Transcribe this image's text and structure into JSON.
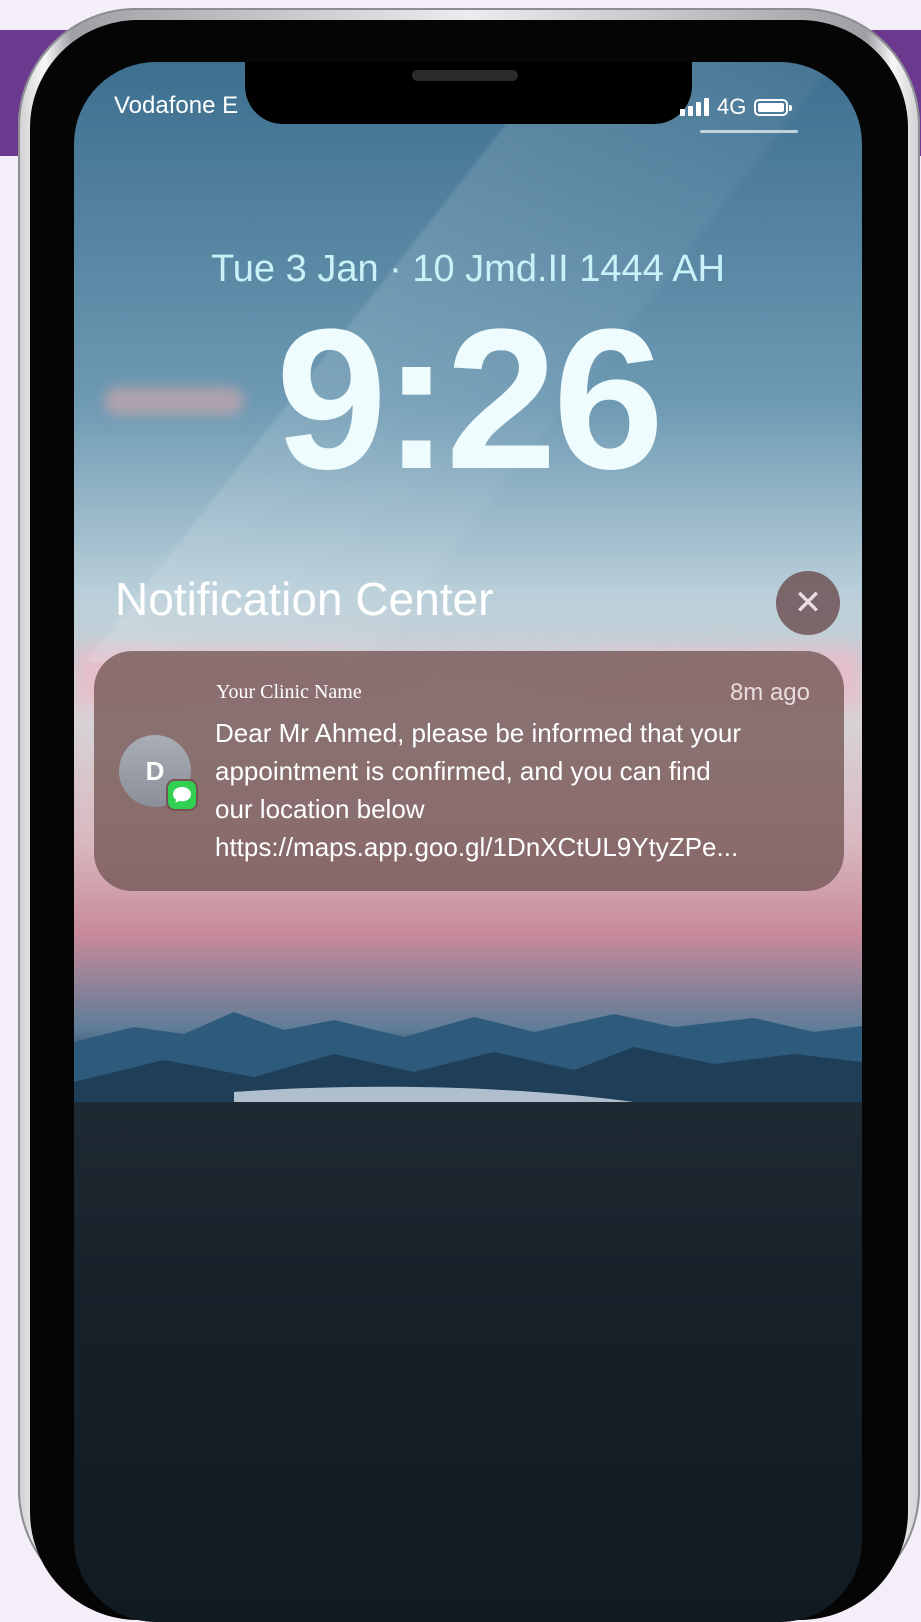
{
  "status_bar": {
    "carrier": "Vodafone E",
    "network": "4G",
    "signal_bars": 4,
    "battery_level": 1.0
  },
  "lock_screen": {
    "date": "Tue 3 Jan · 10 Jmd.II 1444 AH",
    "time": "9:26"
  },
  "notification_center": {
    "title": "Notification Center",
    "close_icon": "close-icon"
  },
  "notifications": [
    {
      "app_name": "Your Clinic Name",
      "time_ago": "8m ago",
      "avatar_initial": "D",
      "badge_icon": "messages-icon",
      "body_lines": [
        "Dear Mr Ahmed, please be informed that your",
        "appointment is confirmed, and you can find",
        "our location below",
        "https://maps.app.goo.gl/1DnXCtUL9YtyZPe..."
      ]
    }
  ],
  "colors": {
    "brand_band": "#6b3a8f",
    "page_background": "#f4eef9",
    "message_badge": "#32d050",
    "date_text": "#c9f2f8"
  }
}
